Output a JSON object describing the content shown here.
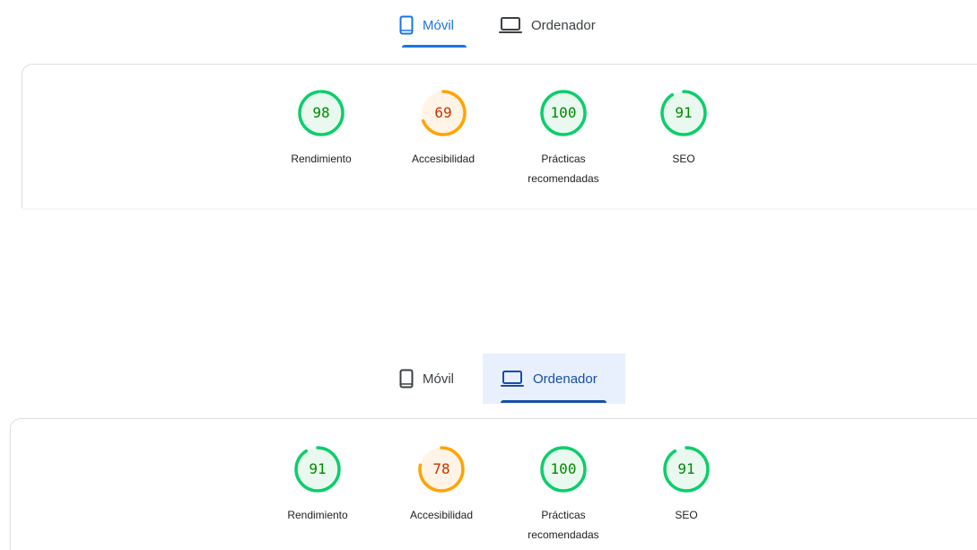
{
  "colors": {
    "accent": "#1a73e8",
    "pass": "#0cce6b",
    "pass_text": "#008800",
    "pass_fill": "#e9f9ef",
    "average": "#ffa400",
    "average_text": "#c33300",
    "average_fill": "#fff4e5"
  },
  "panels": [
    {
      "tabs": [
        {
          "label": "Móvil",
          "icon": "smartphone-icon",
          "state": "active"
        },
        {
          "label": "Ordenador",
          "icon": "laptop-icon",
          "state": "inactive"
        }
      ],
      "scores": [
        {
          "value": 98,
          "label": "Rendimiento",
          "status": "pass"
        },
        {
          "value": 69,
          "label": "Accesibilidad",
          "status": "average"
        },
        {
          "value": 100,
          "label": "Prácticas recomendadas",
          "status": "pass"
        },
        {
          "value": 91,
          "label": "SEO",
          "status": "pass"
        }
      ]
    },
    {
      "tabs": [
        {
          "label": "Móvil",
          "icon": "smartphone-icon",
          "state": "inactive"
        },
        {
          "label": "Ordenador",
          "icon": "laptop-icon",
          "state": "hovered"
        }
      ],
      "scores": [
        {
          "value": 91,
          "label": "Rendimiento",
          "status": "pass"
        },
        {
          "value": 78,
          "label": "Accesibilidad",
          "status": "average"
        },
        {
          "value": 100,
          "label": "Prácticas recomendadas",
          "status": "pass"
        },
        {
          "value": 91,
          "label": "SEO",
          "status": "pass"
        }
      ]
    }
  ]
}
